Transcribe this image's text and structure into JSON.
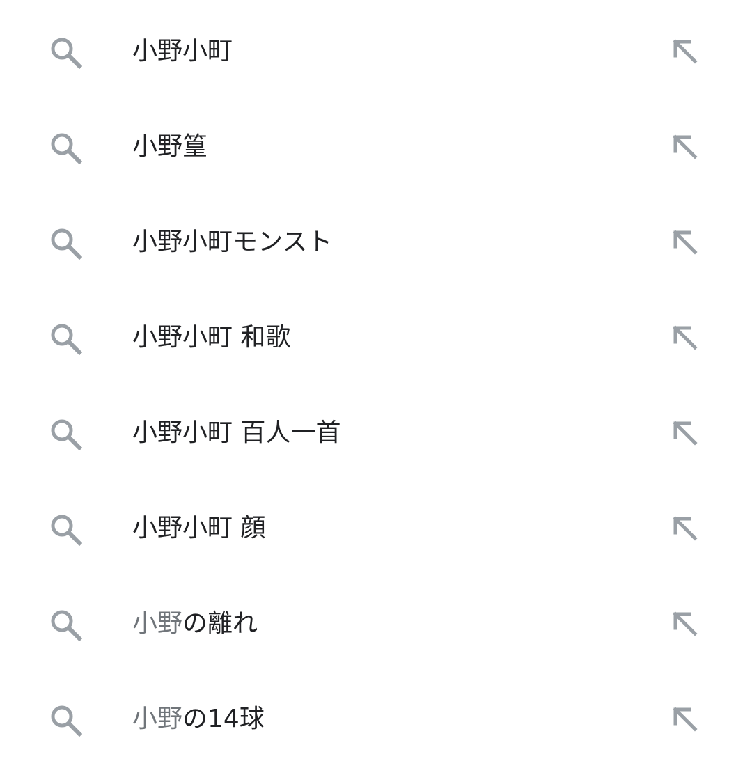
{
  "colors": {
    "text_primary": "#202124",
    "text_secondary": "#70757a",
    "icon": "#9aa0a6",
    "background": "#ffffff"
  },
  "icons": {
    "leading": "search-icon",
    "trailing": "arrow-up-left-icon"
  },
  "suggestions": [
    {
      "prefix": "",
      "text": "小野小町"
    },
    {
      "prefix": "",
      "text": "小野篁"
    },
    {
      "prefix": "",
      "text": "小野小町モンスト"
    },
    {
      "prefix": "",
      "text": "小野小町 和歌"
    },
    {
      "prefix": "",
      "text": "小野小町 百人一首"
    },
    {
      "prefix": "",
      "text": "小野小町 顔"
    },
    {
      "prefix": "小野",
      "text": "の離れ"
    },
    {
      "prefix": "小野",
      "text": "の14球"
    }
  ]
}
